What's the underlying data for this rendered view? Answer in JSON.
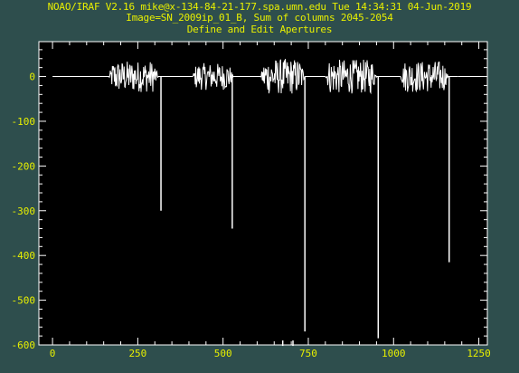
{
  "header": {
    "line1": "NOAO/IRAF V2.16 mike@x-134-84-21-177.spa.umn.edu Tue 14:34:31 04-Jun-2019",
    "line2": "Image=SN_2009ip_01_B, Sum of columns 2045-2054",
    "line3": "Define and Edit Apertures"
  },
  "colors": {
    "background": "#2e4e4d",
    "plot_background": "#000000",
    "axis": "#ffffff",
    "text": "#e8f000",
    "trace": "#ffffff"
  },
  "chart_data": {
    "type": "line",
    "title": "",
    "xlabel": "",
    "ylabel": "",
    "xlim": [
      -40,
      1275
    ],
    "ylim": [
      -600,
      78
    ],
    "x_ticks": [
      0,
      250,
      500,
      750,
      1000,
      1250
    ],
    "x_tick_labels": [
      "0",
      "250",
      "500",
      "750",
      "1000",
      "1250"
    ],
    "y_ticks": [
      -600,
      -500,
      -400,
      -300,
      -200,
      -100,
      0
    ],
    "y_tick_labels": [
      "-600",
      "-500",
      "-400",
      "-300",
      "-200",
      "-100",
      "0"
    ],
    "baseline": 0,
    "noise_regions": [
      {
        "x": [
          165,
          310
        ],
        "amplitude": 35
      },
      {
        "x": [
          410,
          530
        ],
        "amplitude": 30
      },
      {
        "x": [
          610,
          740
        ],
        "amplitude": 40
      },
      {
        "x": [
          800,
          950
        ],
        "amplitude": 38
      },
      {
        "x": [
          1020,
          1160
        ],
        "amplitude": 35
      }
    ],
    "dips": [
      {
        "x": 318,
        "min": -300
      },
      {
        "x": 527,
        "min": -340
      },
      {
        "x": 740,
        "min": -570
      },
      {
        "x": 955,
        "min": -585
      },
      {
        "x": 1163,
        "min": -415
      }
    ],
    "extra_marks": [
      {
        "x": 675,
        "y": -590
      },
      {
        "x": 705,
        "y": -590
      }
    ]
  }
}
